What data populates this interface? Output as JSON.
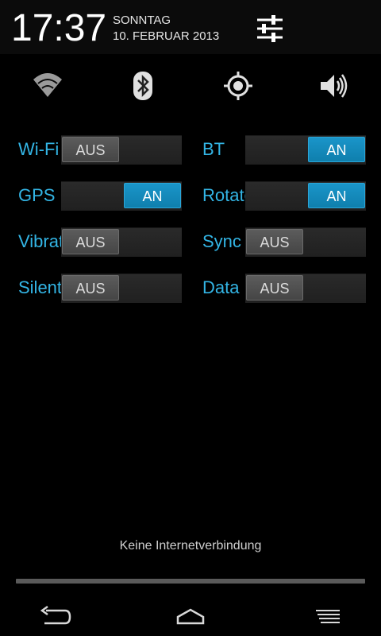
{
  "header": {
    "time": "17:37",
    "weekday": "SONNTAG",
    "date": "10. FEBRUAR 2013",
    "settings_icon": "settings-sliders-icon"
  },
  "quick_icons": [
    {
      "name": "wifi-icon"
    },
    {
      "name": "bluetooth-icon"
    },
    {
      "name": "gps-icon"
    },
    {
      "name": "volume-icon"
    }
  ],
  "toggles": {
    "wifi": {
      "label": "Wi-Fi",
      "state": "AUS"
    },
    "bt": {
      "label": "BT",
      "state": "AN"
    },
    "gps": {
      "label": "GPS",
      "state": "AN"
    },
    "rotate": {
      "label": "Rotate",
      "state": "AN"
    },
    "vibrate": {
      "label": "Vibrate",
      "state": "AUS"
    },
    "sync": {
      "label": "Sync",
      "state": "AUS"
    },
    "silent": {
      "label": "Silent",
      "state": "AUS"
    },
    "data": {
      "label": "Data",
      "state": "AUS"
    }
  },
  "network_status": "Keine Internetverbindung",
  "colors": {
    "accent": "#33b5e5",
    "on_thumb": "#1a95c9",
    "off_thumb": "#4f4f4f",
    "background": "#000000"
  },
  "navbar": {
    "back_icon": "back-icon",
    "home_icon": "home-icon",
    "recents_icon": "recents-icon"
  }
}
